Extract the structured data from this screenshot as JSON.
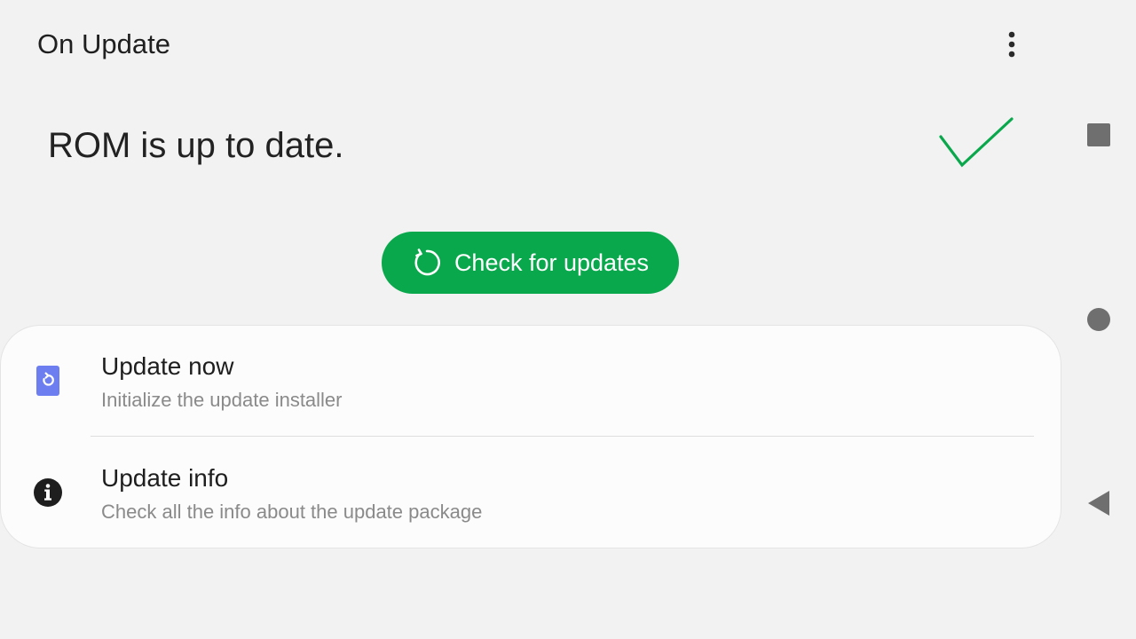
{
  "app": {
    "title": "On Update"
  },
  "status": {
    "message": "ROM is up to date.",
    "state_icon": "check-icon",
    "accent_color": "#0aa84c"
  },
  "actions": {
    "check_label": "Check for updates",
    "check_icon": "refresh-icon"
  },
  "menu": {
    "icon": "more-vert-icon"
  },
  "list": {
    "items": [
      {
        "title": "Update now",
        "subtitle": "Initialize the update installer",
        "icon": "update-icon"
      },
      {
        "title": "Update info",
        "subtitle": "Check all the info about the update package",
        "icon": "info-icon"
      }
    ]
  },
  "navigation": {
    "buttons": [
      "recents-icon",
      "home-icon",
      "back-icon"
    ]
  }
}
